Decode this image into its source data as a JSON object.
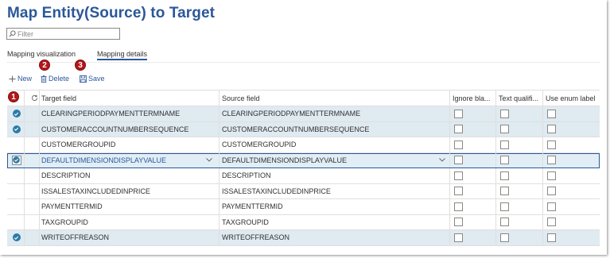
{
  "page": {
    "title": "Map Entity(Source) to Target"
  },
  "filter": {
    "placeholder": "Filter"
  },
  "tabs": [
    {
      "label": "Mapping visualization",
      "active": false
    },
    {
      "label": "Mapping details",
      "active": true
    }
  ],
  "toolbar": {
    "new_label": "New",
    "delete_label": "Delete",
    "save_label": "Save"
  },
  "callouts": [
    "1",
    "2",
    "3"
  ],
  "grid": {
    "columns": [
      "Target field",
      "Source field",
      "Ignore bla...",
      "Text qualifi...",
      "Use enum label"
    ],
    "rows": [
      {
        "target": "CLEARINGPERIODPAYMENTTERMNAME",
        "source": "CLEARINGPERIODPAYMENTTERMNAME",
        "selected": true
      },
      {
        "target": "CUSTOMERACCOUNTNUMBERSEQUENCE",
        "source": "CUSTOMERACCOUNTNUMBERSEQUENCE",
        "selected": true
      },
      {
        "target": "CUSTOMERGROUPID",
        "source": "CUSTOMERGROUPID",
        "selected": false
      },
      {
        "target": "DEFAULTDIMENSIONDISPLAYVALUE",
        "source": "DEFAULTDIMENSIONDISPLAYVALUE",
        "selected": true,
        "focused": true
      },
      {
        "target": "DESCRIPTION",
        "source": "DESCRIPTION",
        "selected": false
      },
      {
        "target": "ISSALESTAXINCLUDEDINPRICE",
        "source": "ISSALESTAXINCLUDEDINPRICE",
        "selected": false
      },
      {
        "target": "PAYMENTTERMID",
        "source": "PAYMENTTERMID",
        "selected": false
      },
      {
        "target": "TAXGROUPID",
        "source": "TAXGROUPID",
        "selected": false
      },
      {
        "target": "WRITEOFFREASON",
        "source": "WRITEOFFREASON",
        "selected": true
      }
    ]
  },
  "colors": {
    "accent": "#2b579a",
    "callout": "#b4171a",
    "selected_row": "#dfeaf1",
    "check": "#2b7aa8"
  },
  "icons": [
    "search-icon",
    "add-icon",
    "delete-icon",
    "save-icon",
    "refresh-icon",
    "checkmark-icon",
    "chevron-down-icon"
  ]
}
